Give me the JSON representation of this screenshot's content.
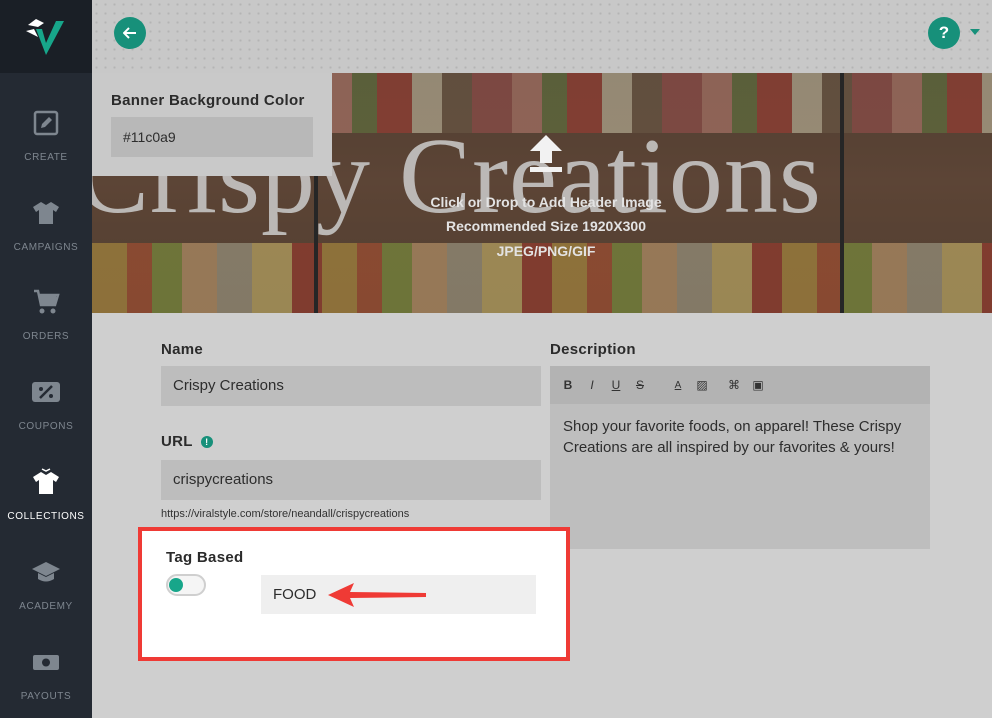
{
  "sidebar": {
    "items": [
      {
        "label": "CREATE",
        "icon": "edit-square-icon"
      },
      {
        "label": "CAMPAIGNS",
        "icon": "tshirt-icon"
      },
      {
        "label": "ORDERS",
        "icon": "cart-icon"
      },
      {
        "label": "COUPONS",
        "icon": "coupon-icon"
      },
      {
        "label": "COLLECTIONS",
        "icon": "collections-shirt-icon",
        "active": true
      },
      {
        "label": "ACADEMY",
        "icon": "graduation-cap-icon"
      },
      {
        "label": "PAYOUTS",
        "icon": "money-icon"
      }
    ]
  },
  "topbar": {
    "back_icon": "arrow-left-icon",
    "help_label": "?"
  },
  "banner_color": {
    "title": "Banner Background Color",
    "value": "#11c0a9"
  },
  "banner": {
    "title": "Crispy Creations",
    "hint_line1": "Click or Drop to Add Header Image",
    "hint_line2": "Recommended Size 1920X300",
    "hint_line3": "JPEG/PNG/GIF"
  },
  "form": {
    "name_label": "Name",
    "name_value": "Crispy Creations",
    "url_label": "URL",
    "url_info": "!",
    "url_value": "crispycreations",
    "url_preview": "https://viralstyle.com/store/neandall/crispycreations",
    "description_label": "Description",
    "toolbar": [
      "B",
      "I",
      "U",
      "S",
      "A",
      "▨",
      "⌘",
      "▣"
    ],
    "description_text": "Shop your favorite foods, on apparel! These Crispy Creations are all inspired by our favorites & yours!",
    "tag_label": "Tag Based",
    "tag_value": "FOOD"
  },
  "colors": {
    "accent": "#17907a",
    "highlight": "#ef3a35"
  }
}
